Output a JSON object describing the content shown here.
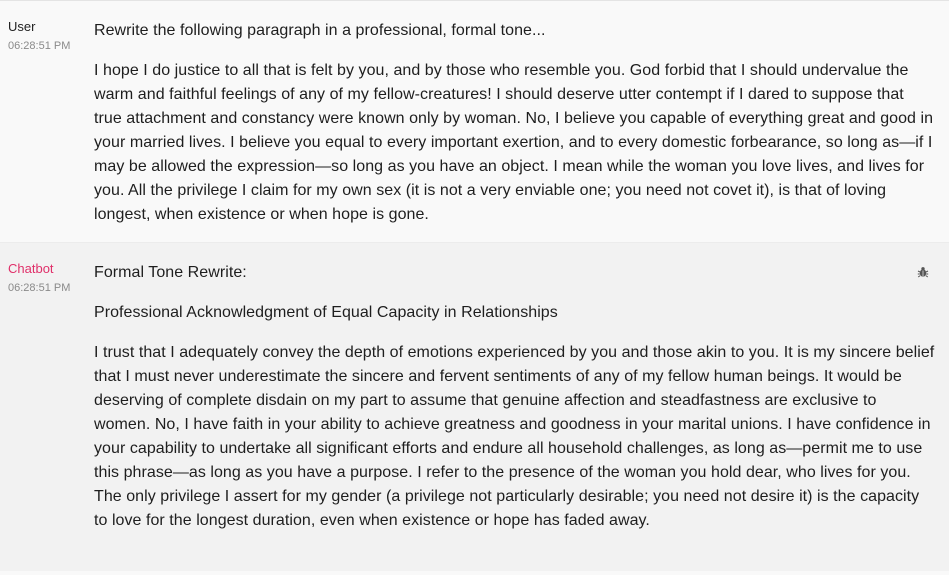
{
  "messages": {
    "user": {
      "author": "User",
      "time": "06:28:51 PM",
      "prompt": "Rewrite the following paragraph in a professional, formal tone...",
      "text": "I hope I do justice to all that is felt by you, and by those who resemble you. God forbid that I should undervalue the warm and faithful feelings of any of my fellow-creatures! I should deserve utter contempt if I dared to suppose that true attachment and constancy were known only by woman. No, I believe you capable of everything great and good in your married lives. I believe you equal to every important exertion, and to every domestic forbearance, so long as—if I may be allowed the expression—so long as you have an object. I mean while the woman you love lives, and lives for you. All the privilege I claim for my own sex (it is not a very enviable one; you need not covet it), is that of loving longest, when existence or when hope is gone."
    },
    "bot": {
      "author": "Chatbot",
      "time": "06:28:51 PM",
      "heading": "Formal Tone Rewrite:",
      "subheading": "Professional Acknowledgment of Equal Capacity in Relationships",
      "text": "I trust that I adequately convey the depth of emotions experienced by you and those akin to you. It is my sincere belief that I must never underestimate the sincere and fervent sentiments of any of my fellow human beings. It would be deserving of complete disdain on my part to assume that genuine affection and steadfastness are exclusive to women. No, I have faith in your ability to achieve greatness and goodness in your marital unions. I have confidence in your capability to undertake all significant efforts and endure all household challenges, as long as—permit me to use this phrase—as long as you have a purpose. I refer to the presence of the woman you hold dear, who lives for you. The only privilege I assert for my gender (a privilege not particularly desirable; you need not desire it) is the capacity to love for the longest duration, even when existence or hope has faded away.",
      "debug_icon": "bug-icon"
    }
  },
  "colors": {
    "bot_name": "#e0306a",
    "user_bg": "#f9f9f9",
    "bot_bg": "#f2f2f2"
  }
}
